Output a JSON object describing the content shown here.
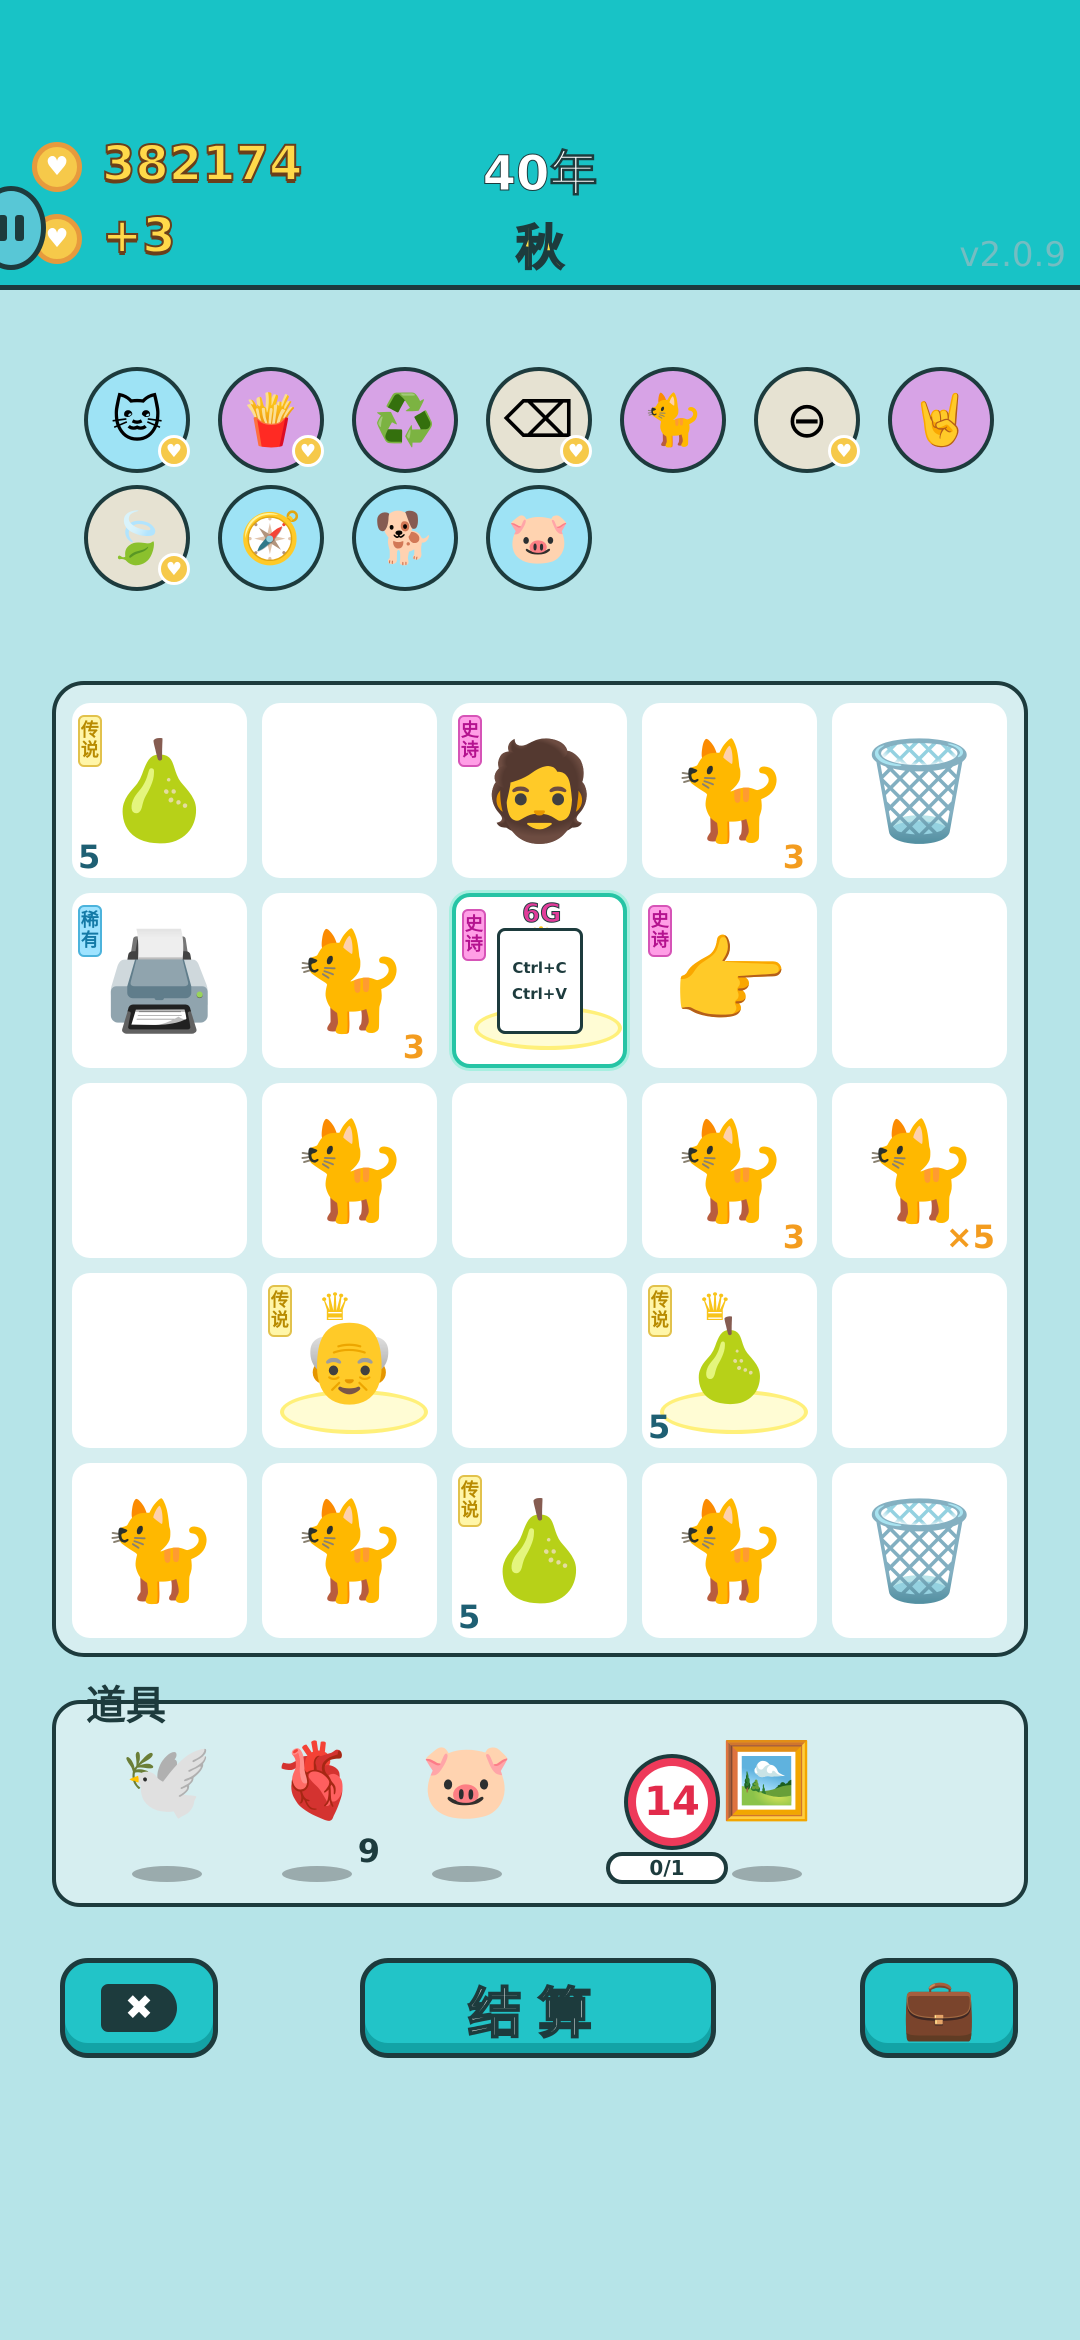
{
  "header": {
    "coins": "382174",
    "income": "+3",
    "year": "40年",
    "season": "秋",
    "version": "v2.0.9"
  },
  "buffs": [
    {
      "icon": "cat-portrait-icon",
      "glyph": "🐱",
      "bg": "#9ee3f5",
      "heart": true
    },
    {
      "icon": "fries-icon",
      "glyph": "🍟",
      "bg": "#d7a3e6",
      "heart": true
    },
    {
      "icon": "recycle-icon",
      "glyph": "♻️",
      "bg": "#d7a3e6",
      "heart": false
    },
    {
      "icon": "delete-key-icon",
      "glyph": "⌫",
      "bg": "#e6e2d2",
      "heart": true
    },
    {
      "icon": "twin-cats-icon",
      "glyph": "🐈",
      "bg": "#d7a3e6",
      "heart": false
    },
    {
      "icon": "minus-circle-icon",
      "glyph": "⊖",
      "bg": "#e6e2d2",
      "heart": true
    },
    {
      "icon": "rock-hand-icon",
      "glyph": "🤘",
      "bg": "#d7a3e6",
      "heart": false
    },
    {
      "icon": "leaf-icon",
      "glyph": "🍃",
      "bg": "#e6e2d2",
      "heart": true
    },
    {
      "icon": "compass-icon",
      "glyph": "🧭",
      "bg": "#9ee3f5",
      "heart": false
    },
    {
      "icon": "cool-dog-icon",
      "glyph": "🐕",
      "bg": "#9ee3f5",
      "heart": false
    },
    {
      "icon": "piggy-bank-icon",
      "glyph": "🐷",
      "bg": "#9ee3f5",
      "heart": false
    }
  ],
  "board": [
    {
      "symbol": "pear",
      "glyph": "🍐",
      "tag": "传说",
      "tag_type": "legend",
      "count": "5",
      "count_pos": "bl"
    },
    {
      "symbol": "empty"
    },
    {
      "symbol": "bearded-man",
      "glyph": "🧔",
      "tag": "史诗",
      "tag_type": "epic"
    },
    {
      "symbol": "cat",
      "glyph": "🐈",
      "count": "3",
      "count_pos": "br"
    },
    {
      "symbol": "trash-bag",
      "glyph": "🗑️"
    },
    {
      "symbol": "printer",
      "glyph": "🖨️",
      "tag": "稀有",
      "tag_type": "rare"
    },
    {
      "symbol": "cat",
      "glyph": "🐈",
      "count": "3",
      "count_pos": "br"
    },
    {
      "symbol": "copy-paste-card",
      "glyph": "",
      "tag": "史诗",
      "tag_type": "epic",
      "text1": "Ctrl+C",
      "text2": "Ctrl+V",
      "top": "6G",
      "selected": true
    },
    {
      "symbol": "pointing-hand",
      "glyph": "👉",
      "tag": "史诗",
      "tag_type": "epic"
    },
    {
      "symbol": "empty"
    },
    {
      "symbol": "empty"
    },
    {
      "symbol": "cat",
      "glyph": "🐈"
    },
    {
      "symbol": "empty"
    },
    {
      "symbol": "cat",
      "glyph": "🐈",
      "count": "3",
      "count_pos": "br"
    },
    {
      "symbol": "cat",
      "glyph": "🐈",
      "count": "×5",
      "count_pos": "br"
    },
    {
      "symbol": "empty"
    },
    {
      "symbol": "crowned-old-man",
      "glyph": "👴",
      "tag": "传说",
      "tag_type": "legend",
      "crowned": true
    },
    {
      "symbol": "empty"
    },
    {
      "symbol": "crowned-pear",
      "glyph": "🍐",
      "tag": "传说",
      "tag_type": "legend",
      "count": "5",
      "count_pos": "bl",
      "crowned": true
    },
    {
      "symbol": "empty"
    },
    {
      "symbol": "cat",
      "glyph": "🐈"
    },
    {
      "symbol": "cat",
      "glyph": "🐈"
    },
    {
      "symbol": "pear",
      "glyph": "🍐",
      "tag": "传说",
      "tag_type": "legend",
      "count": "5",
      "count_pos": "bl"
    },
    {
      "symbol": "cat",
      "glyph": "🐈"
    },
    {
      "symbol": "trash-bag",
      "glyph": "🗑️"
    }
  ],
  "items": {
    "label": "道具",
    "list": [
      {
        "icon": "dove-icon",
        "glyph": "🕊️"
      },
      {
        "icon": "liver-icon",
        "glyph": "🫀",
        "count": "9"
      },
      {
        "icon": "piggy-bank-icon",
        "glyph": "🐷"
      },
      {
        "icon": "target-counter-icon",
        "value": "14",
        "progress": "0/1"
      },
      {
        "icon": "blank-frame-icon",
        "glyph": "🖼️"
      }
    ]
  },
  "buttons": {
    "remove_glyph": "✖",
    "settle_label": "结算",
    "inventory_glyph": "💼"
  }
}
